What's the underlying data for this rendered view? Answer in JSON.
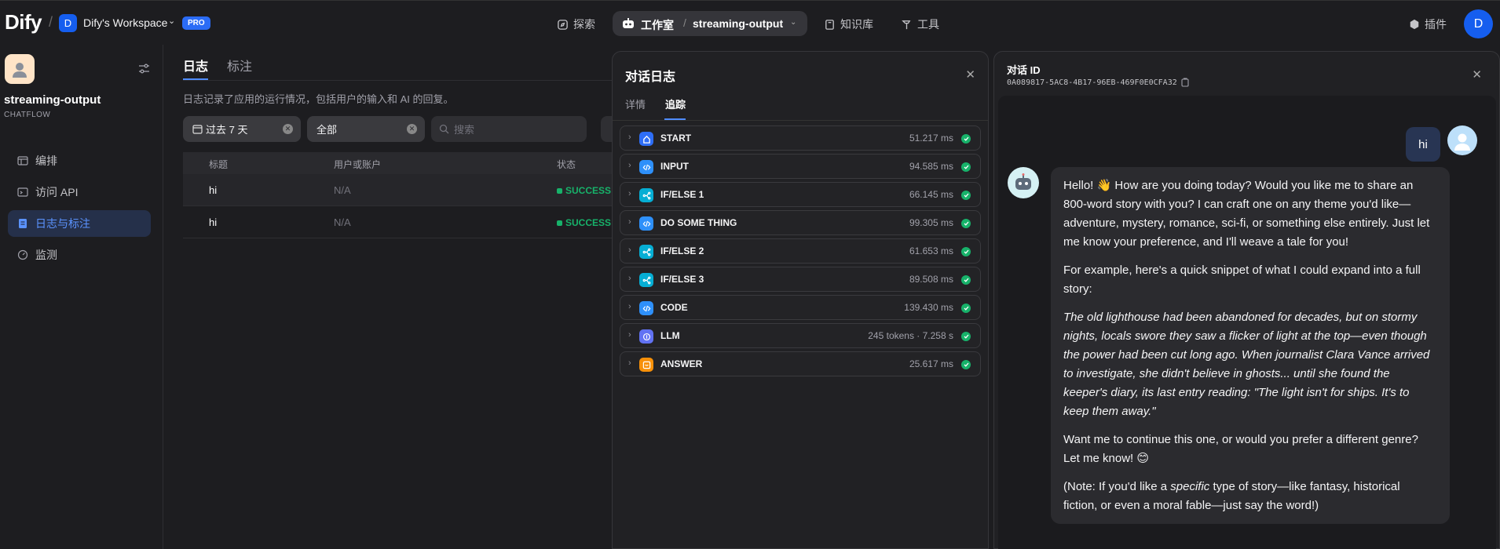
{
  "topbar": {
    "logo": "Dify",
    "workspace_initial": "D",
    "workspace_name": "Dify's Workspace",
    "plan_badge": "PRO",
    "nav": {
      "explore": "探索",
      "studio": "工作室",
      "current_app": "streaming-output",
      "knowledge": "知识库",
      "tools": "工具"
    },
    "plugins": "插件",
    "user_initial": "D"
  },
  "sidebar": {
    "app_name": "streaming-output",
    "app_type": "CHATFLOW",
    "items": [
      {
        "label": "编排",
        "icon": "layout-icon"
      },
      {
        "label": "访问 API",
        "icon": "terminal-icon"
      },
      {
        "label": "日志与标注",
        "icon": "file-list-icon",
        "active": true
      },
      {
        "label": "监测",
        "icon": "gauge-icon"
      }
    ]
  },
  "main": {
    "tabs": [
      "日志",
      "标注"
    ],
    "description": "日志记录了应用的运行情况，包括用户的输入和 AI 的回复。",
    "filters": {
      "period": "过去 7 天",
      "status": "全部",
      "search_placeholder": "搜索"
    },
    "columns": [
      "标题",
      "用户或账户",
      "状态"
    ],
    "rows": [
      {
        "title": "hi",
        "user": "N/A",
        "status": "SUCCESS"
      },
      {
        "title": "hi",
        "user": "N/A",
        "status": "SUCCESS"
      }
    ]
  },
  "trace_panel": {
    "title": "对话日志",
    "tabs": [
      "详情",
      "追踪"
    ],
    "nodes": [
      {
        "name": "START",
        "time": "51.217 ms",
        "color": "#2e6ef7",
        "icon": "home-icon"
      },
      {
        "name": "INPUT",
        "time": "94.585 ms",
        "color": "#2e90fa",
        "icon": "code-icon"
      },
      {
        "name": "IF/ELSE 1",
        "time": "66.145 ms",
        "color": "#06aed4",
        "icon": "branch-icon"
      },
      {
        "name": "DO SOME THING",
        "time": "99.305 ms",
        "color": "#2e90fa",
        "icon": "code-icon"
      },
      {
        "name": "IF/ELSE 2",
        "time": "61.653 ms",
        "color": "#06aed4",
        "icon": "branch-icon"
      },
      {
        "name": "IF/ELSE 3",
        "time": "89.508 ms",
        "color": "#06aed4",
        "icon": "branch-icon"
      },
      {
        "name": "CODE",
        "time": "139.430 ms",
        "color": "#2e90fa",
        "icon": "code-icon"
      },
      {
        "name": "LLM",
        "time": "245 tokens · 7.258 s",
        "color": "#6172f3",
        "icon": "brain-icon"
      },
      {
        "name": "ANSWER",
        "time": "25.617 ms",
        "color": "#f79009",
        "icon": "message-icon"
      }
    ]
  },
  "chat_panel": {
    "title": "对话 ID",
    "conversation_id": "0A089817-5AC8-4B17-96EB-469F0E0CFA32",
    "question": "hi",
    "answer": {
      "p1": "Hello! 👋 How are you doing today? Would you like me to share an 800-word story with you? I can craft one on any theme you'd like—adventure, mystery, romance, sci-fi, or something else entirely. Just let me know your preference, and I'll weave a tale for you!",
      "p2": "For example, here's a quick snippet of what I could expand into a full story:",
      "p3": "The old lighthouse had been abandoned for decades, but on stormy nights, locals swore they saw a flicker of light at the top—even though the power had been cut long ago. When journalist Clara Vance arrived to investigate, she didn't believe in ghosts... until she found the keeper's diary, its last entry reading: \"The light isn't for ships. It's to keep them away.\"",
      "p4": "Want me to continue this one, or would you prefer a different genre? Let me know! 😊",
      "p5_before": "(Note: If you'd like a ",
      "p5_em": "specific",
      "p5_after": " type of story—like fantasy, historical fiction, or even a moral fable—just say the word!)"
    }
  }
}
